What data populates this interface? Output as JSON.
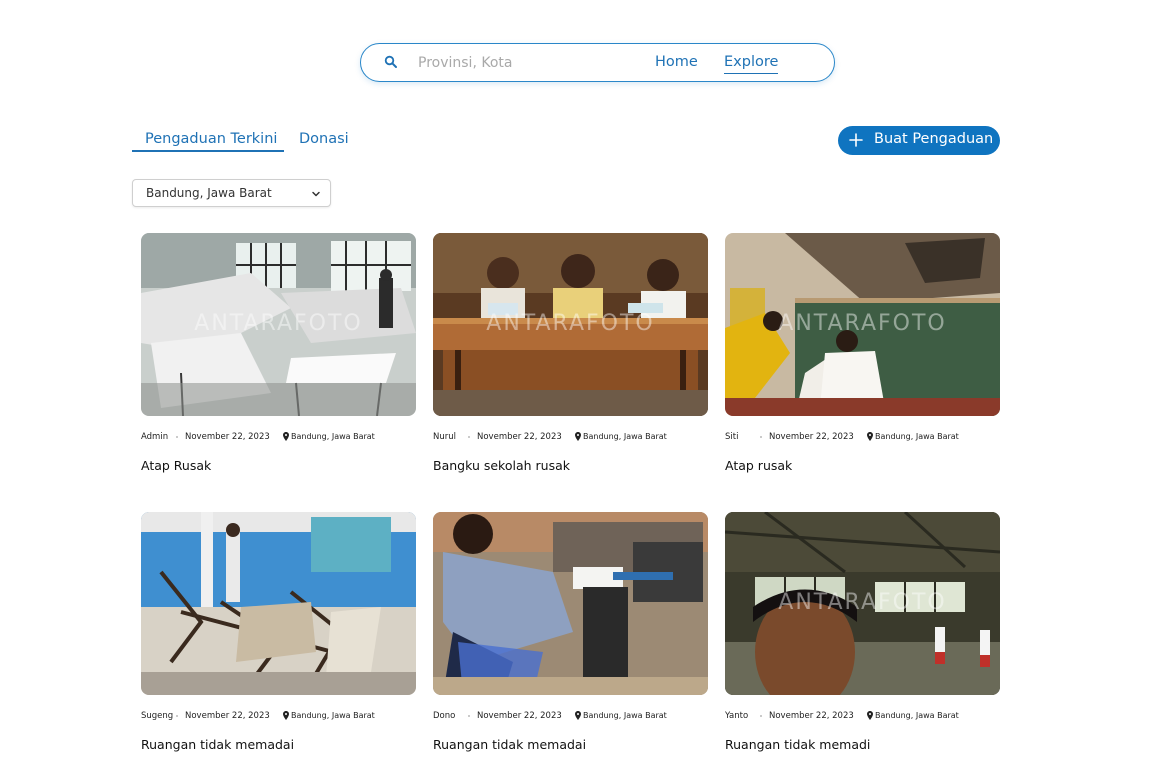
{
  "nav": {
    "search_placeholder": "Provinsi, Kota",
    "home_label": "Home",
    "explore_label": "Explore",
    "accent_color": "#1f72b5"
  },
  "tabs": {
    "active": "Pengaduan Terkini",
    "items": [
      {
        "label": "Pengaduan Terkini"
      },
      {
        "label": "Donasi"
      }
    ]
  },
  "cta": {
    "label": "Buat Pengaduan",
    "icon": "plus-icon",
    "color": "#0f74c0"
  },
  "location_filter": {
    "selected": "Bandung, Jawa Barat",
    "icon": "chevron-down-icon"
  },
  "cards": [
    {
      "author": "Admin",
      "date": "November 22, 2023",
      "location": "Bandung, Jawa Barat",
      "title": "Atap Rusak",
      "watermark": "ANTARAFOTO"
    },
    {
      "author": "Nurul",
      "date": "November 22, 2023",
      "location": "Bandung, Jawa Barat",
      "title": "Bangku sekolah rusak",
      "watermark": "ANTARAFOTO"
    },
    {
      "author": "Siti",
      "date": "November 22, 2023",
      "location": "Bandung, Jawa Barat",
      "title": "Atap rusak",
      "watermark": "ANTARAFOTO"
    },
    {
      "author": "Sugeng",
      "date": "November 22, 2023",
      "location": "Bandung, Jawa Barat",
      "title": "Ruangan tidak memadai",
      "watermark": ""
    },
    {
      "author": "Dono",
      "date": "November 22, 2023",
      "location": "Bandung, Jawa Barat",
      "title": "Ruangan tidak memadai",
      "watermark": ""
    },
    {
      "author": "Yanto",
      "date": "November 22, 2023",
      "location": "Bandung, Jawa Barat",
      "title": "Ruangan tidak memadi",
      "watermark": "ANTARAFOTO"
    }
  ]
}
